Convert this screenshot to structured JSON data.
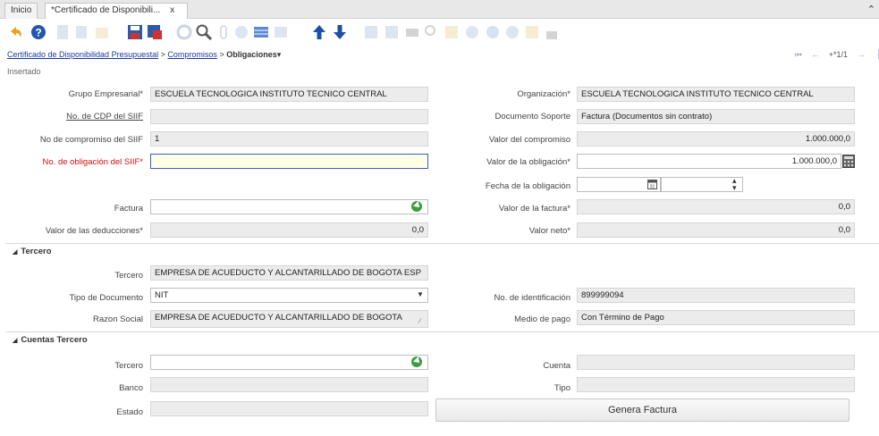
{
  "tabs": [
    {
      "label": "Inicio"
    },
    {
      "label": "*Certificado de Disponibili...",
      "close": "x"
    }
  ],
  "breadcrumb": {
    "item1": "Certificado de Disponibilidad Presupuestal",
    "sep1": ">",
    "item2": "Compromisos",
    "sep2": ">",
    "item3": "Obligaciones",
    "caret": "▾"
  },
  "record_nav": {
    "counter": "+*1/1"
  },
  "status": "Insertado",
  "form": {
    "grupo_empresarial": {
      "label": "Grupo Empresarial*",
      "value": "ESCUELA TECNOLOGICA INSTITUTO TECNICO CENTRAL"
    },
    "organizacion": {
      "label": "Organización*",
      "value": "ESCUELA TECNOLOGICA INSTITUTO TECNICO CENTRAL"
    },
    "no_cdp": {
      "label": "No. de CDP del SIIF",
      "value": ""
    },
    "documento_soporte": {
      "label": "Documento Soporte",
      "value": "Factura (Documentos sin contrato)"
    },
    "no_compromiso": {
      "label": "No de compromiso del SIIF",
      "value": "1"
    },
    "valor_compromiso": {
      "label": "Valor del compromiso",
      "value": "1.000.000,0"
    },
    "no_obligacion": {
      "label": "No. de obligación del SIIF*",
      "value": ""
    },
    "valor_obligacion": {
      "label": "Valor de la obligación*",
      "value": "1.000.000,0"
    },
    "fecha_obligacion": {
      "label": "Fecha de la obligación",
      "value": ""
    },
    "factura": {
      "label": "Factura",
      "value": ""
    },
    "valor_factura": {
      "label": "Valor de la factura*",
      "value": "0,0"
    },
    "valor_deducciones": {
      "label": "Valor de las deducciones*",
      "value": "0,0"
    },
    "valor_neto": {
      "label": "Valor neto*",
      "value": "0,0"
    }
  },
  "tercero_section": {
    "title": "Tercero",
    "tercero": {
      "label": "Tercero",
      "value": "EMPRESA DE ACUEDUCTO Y ALCANTARILLADO DE BOGOTA ESP"
    },
    "tipo_documento": {
      "label": "Tipo de Documento",
      "value": "NIT"
    },
    "no_identificacion": {
      "label": "No. de identificación",
      "value": "899999094"
    },
    "razon_social": {
      "label": "Razon Social",
      "value": "EMPRESA DE ACUEDUCTO Y ALCANTARILLADO DE BOGOTA"
    },
    "medio_pago": {
      "label": "Medio de pago",
      "value": "Con Término de Pago"
    }
  },
  "cuentas_section": {
    "title": "Cuentas Tercero",
    "tercero": {
      "label": "Tercero",
      "value": ""
    },
    "cuenta": {
      "label": "Cuenta",
      "value": ""
    },
    "banco": {
      "label": "Banco",
      "value": ""
    },
    "tipo": {
      "label": "Tipo",
      "value": ""
    },
    "estado": {
      "label": "Estado",
      "value": ""
    },
    "genera_factura": "Genera Factura"
  }
}
